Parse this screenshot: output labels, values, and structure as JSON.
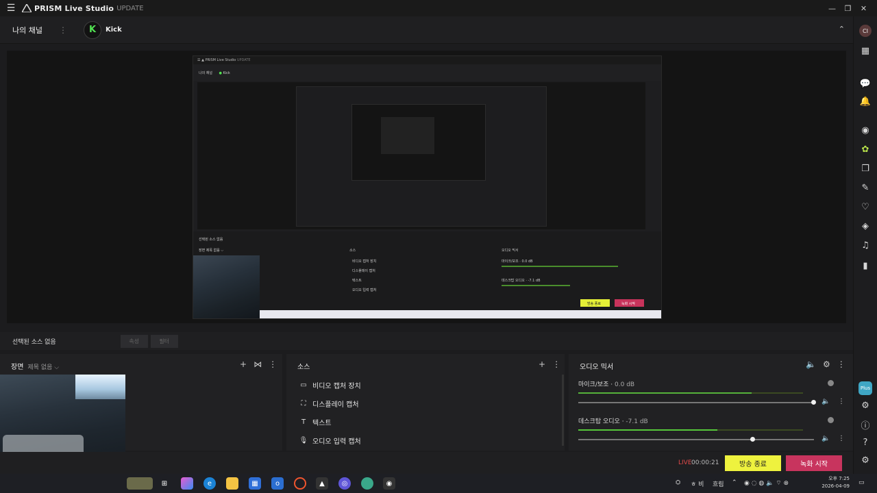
{
  "app": {
    "title": "PRISM Live Studio",
    "update": "UPDATE"
  },
  "channel": {
    "my_channel": "나의 채널",
    "platform": "Kick",
    "platform_logo_letter": "K"
  },
  "sidebar": {
    "avatar": "CI",
    "plus_badge": "Plus",
    "icons": [
      "layout-icon",
      "chat-icon",
      "bell-icon",
      "camera-icon",
      "effects-icon",
      "copy-icon",
      "signature-icon",
      "heart-icon",
      "sticker-icon",
      "music-icon",
      "battery-icon",
      "dashboard-icon",
      "info-icon",
      "help-icon",
      "settings-icon"
    ]
  },
  "selected_source": {
    "label": "선택된 소스 없음",
    "btn1": "속성",
    "btn2": "필터"
  },
  "scene_panel": {
    "title": "장면",
    "scene_name": "제목 없음 ⌵"
  },
  "source_panel": {
    "title": "소스",
    "items": [
      {
        "label": "비디오 캡처 장치",
        "icon": "video-camera-icon"
      },
      {
        "label": "디스플레이 캡처",
        "icon": "display-capture-icon"
      },
      {
        "label": "텍스트",
        "icon": "text-icon"
      },
      {
        "label": "오디오 입력 캡처",
        "icon": "microphone-icon"
      }
    ]
  },
  "mixer": {
    "title": "오디오 믹서",
    "channels": [
      {
        "name": "마이크/보조",
        "db": "0.0 dB",
        "level": 0.77,
        "volume": 1.0
      },
      {
        "name": "데스크탑 오디오",
        "db": "-7.1 dB",
        "level": 0.62,
        "volume": 0.74
      }
    ]
  },
  "status": {
    "live": "LIVE",
    "time": "00:00:21",
    "end_broadcast": "방송 종료",
    "start_recording": "녹화 시작"
  },
  "preview_inner": {
    "title": "PRISM Live Studio",
    "update": "UPDATE",
    "my_channel": "나의 채널",
    "platform": "Kick",
    "no_source": "선택된 소스 없음",
    "scene": "장면  제목 없음 ⌵",
    "sources": "소스",
    "mixer": "오디오 믹서",
    "items": [
      "비디오 캡처 장치",
      "디스플레이 캡처",
      "텍스트",
      "오디오 입력 캡처"
    ],
    "mic": "마이크/보조 · 0.0 dB",
    "desk": "데스크탑 오디오 · -7.1 dB",
    "btn_end": "방송 종료",
    "btn_rec": "녹화 시작"
  },
  "taskbar": {
    "weather": "흐림",
    "lang": "ㅎ 비",
    "time": "오후 7:25",
    "date": "2026-04-09"
  }
}
